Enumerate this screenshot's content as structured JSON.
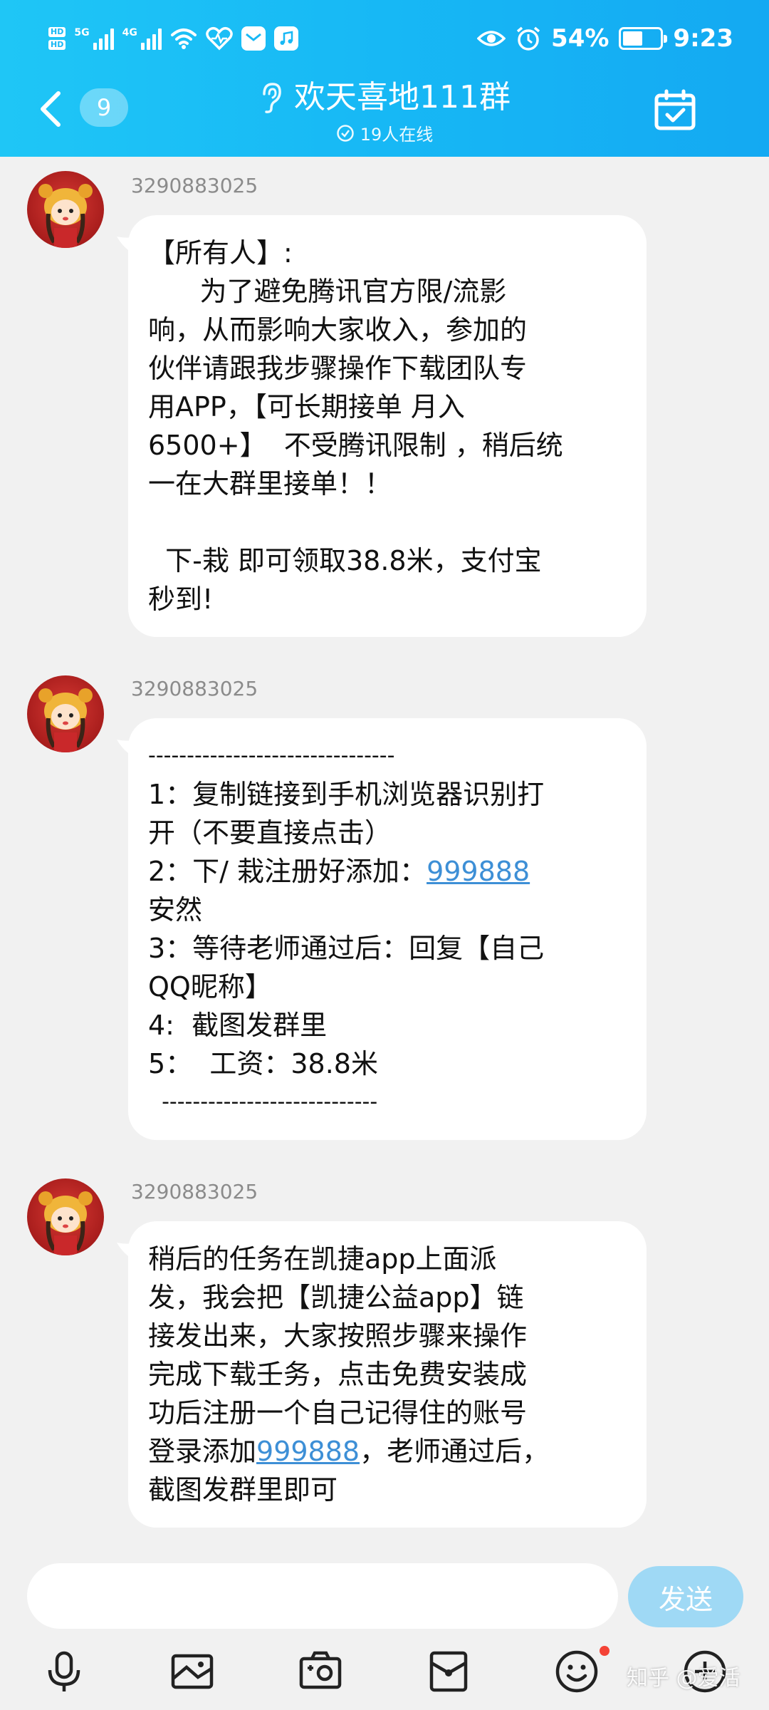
{
  "status_bar": {
    "hd_tags": [
      "HD",
      "HD"
    ],
    "signal_labels": [
      "5G",
      "4G"
    ],
    "battery_percent": "54%",
    "battery_level": 0.54,
    "time": "9:23",
    "icons": [
      "wifi-icon",
      "health-icon",
      "message-icon",
      "music-icon",
      "eye-icon",
      "alarm-icon",
      "battery-icon"
    ]
  },
  "header": {
    "unread_count": "9",
    "title": "欢天喜地111群",
    "online_status": "19人在线",
    "colors": {
      "top": "#1fc6f6",
      "bottom": "#14a9f2"
    }
  },
  "messages": [
    {
      "sender": "3290883025",
      "lines": [
        "【所有人】:",
        "      为了避免腾讯官方限/流影",
        "响，从而影响大家收入，参加的",
        "伙伴请跟我步骤操作下载团队专",
        "用APP，【可长期接单 月入",
        "6500+】  不受腾讯限制 ，稍后统",
        "一在大群里接单！！",
        "",
        "  下-栽 即可领取38.8米，支付宝",
        "秒到!"
      ]
    },
    {
      "sender": "3290883025",
      "lines_before": [
        "--------------------------------",
        "1：复制链接到手机浏览器识别打",
        "开（不要直接点击）"
      ],
      "line4_prefix": "2：下/ 栽注册好添加：",
      "link": "999888",
      "lines_after": [
        "安然",
        "3：等待老师通过后：回复【自己",
        "QQ昵称】",
        "4:  截图发群里",
        "5：  工资：38.8米",
        "  ----------------------------"
      ]
    },
    {
      "sender": "3290883025",
      "lines_before": [
        "稍后的任务在凯捷app上面派",
        "发，我会把【凯捷公益app】链",
        "接发出来，大家按照步骤来操作",
        "完成下载壬务，点击免费安装成",
        "功后注册一个自己记得住的账号"
      ],
      "line6_prefix": "登录添加",
      "link": "999888",
      "line6_suffix": "，老师通过后，",
      "lines_after": [
        "截图发群里即可"
      ]
    }
  ],
  "input": {
    "placeholder": "",
    "send_label": "发送"
  },
  "toolbar": {
    "icons": [
      "microphone-icon",
      "image-icon",
      "camera-icon",
      "red-packet-icon",
      "emoji-icon",
      "plus-icon"
    ]
  },
  "watermark": "知乎 @爱活"
}
